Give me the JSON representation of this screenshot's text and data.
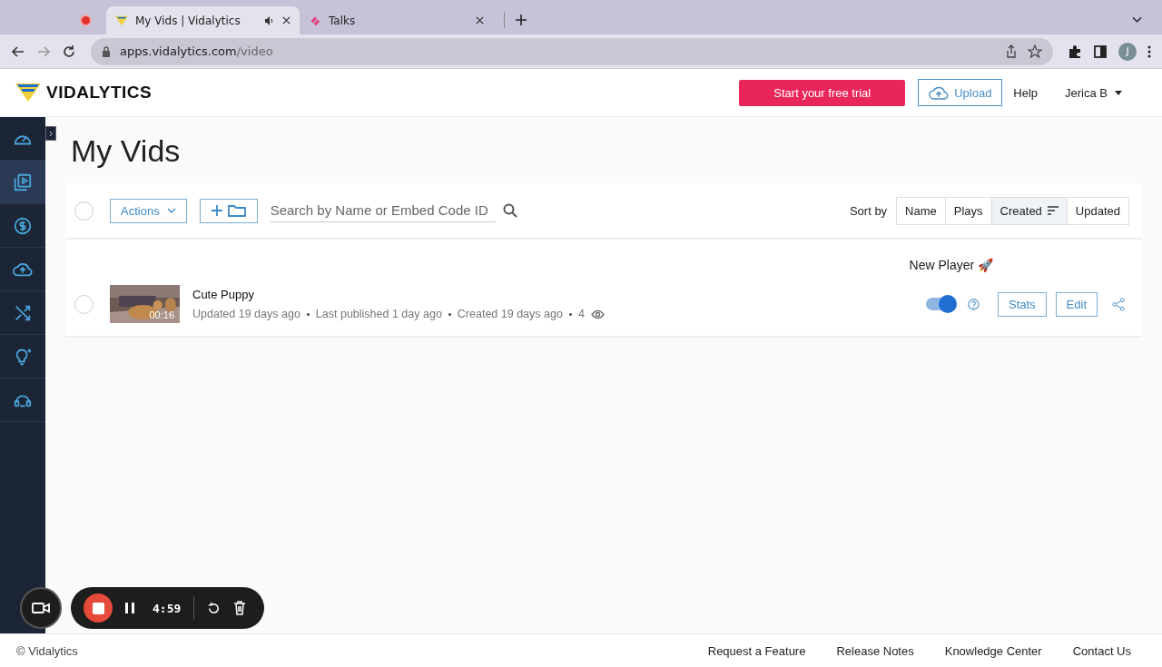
{
  "browser": {
    "tabs": [
      {
        "title": "My Vids | Vidalytics",
        "selected": true,
        "kind": "vidalytics",
        "audio": true
      },
      {
        "title": "Talks",
        "selected": false,
        "kind": "talks",
        "audio": false
      }
    ],
    "url_host": "apps.vidalytics.com",
    "url_path": "/video",
    "profile_initial": "J"
  },
  "header": {
    "logo": "VIDALYTICS",
    "trial_button": "Start your free trial",
    "upload_button": "Upload",
    "help": "Help",
    "user": "Jerica B"
  },
  "sidebar": {
    "items": [
      {
        "kind": "dashboard",
        "selected": false
      },
      {
        "kind": "videos",
        "selected": true
      },
      {
        "kind": "money",
        "selected": false
      },
      {
        "kind": "upload",
        "selected": false
      },
      {
        "kind": "shuffle",
        "selected": false
      },
      {
        "kind": "idea",
        "selected": false
      },
      {
        "kind": "support",
        "selected": false
      }
    ]
  },
  "page_title": "My Vids",
  "toolbar": {
    "select_all_selected": false,
    "actions": "Actions",
    "search_placeholder": "Search by Name or Embed Code ID",
    "sort_label": "Sort by",
    "sort_options": [
      {
        "label": "Name",
        "selected": false
      },
      {
        "label": "Plays",
        "selected": false
      },
      {
        "label": "Created",
        "selected": true
      },
      {
        "label": "Updated",
        "selected": false
      }
    ]
  },
  "player_label": "New Player 🚀",
  "videos": [
    {
      "selected": false,
      "name": "Cute Puppy",
      "duration": "00:16",
      "meta": [
        "Updated 19 days ago",
        "Last published 1 day ago",
        "Created 19 days ago",
        "4"
      ],
      "on": true,
      "stats": "Stats",
      "edit": "Edit"
    }
  ],
  "footer": {
    "copyright": "© Vidalytics",
    "links": [
      "Request a Feature",
      "Release Notes",
      "Knowledge Center",
      "Contact Us"
    ]
  },
  "recorder": {
    "time": "4:59"
  }
}
